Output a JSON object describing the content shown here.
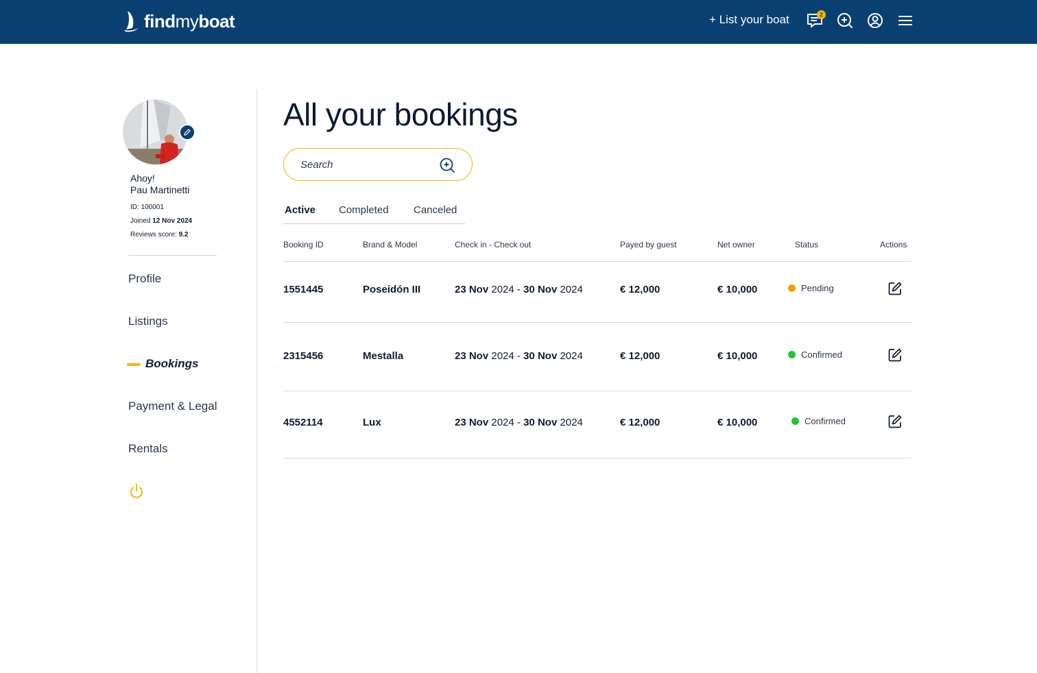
{
  "header": {
    "logo_text_bold_1": "find",
    "logo_text_light": "my",
    "logo_text_bold_2": "boat",
    "list_boat_label": "+ List your boat",
    "messages_badge": "2",
    "brand_color": "#0a3f72",
    "accent_color": "#f2b705"
  },
  "profile": {
    "greeting": "Ahoy!",
    "name": "Pau Martinetti",
    "id_label": "ID: ",
    "id_value": "100001",
    "joined_label": "Joined ",
    "joined_value": "12 Nov 2024",
    "reviews_label": "Reviews score: ",
    "reviews_value": "9.2"
  },
  "sidebar": {
    "items": [
      {
        "label": "Profile"
      },
      {
        "label": "Listings"
      },
      {
        "label": "Bookings"
      },
      {
        "label": "Payment & Legal"
      },
      {
        "label": "Rentals"
      }
    ]
  },
  "main": {
    "title": "All your bookings",
    "search_placeholder": "Search",
    "tabs": [
      {
        "label": "Active"
      },
      {
        "label": "Completed"
      },
      {
        "label": "Canceled"
      }
    ],
    "columns": [
      "Booking ID",
      "Brand & Model",
      "Check in - Check out",
      "Payed by guest",
      "Net owner",
      "Status",
      "Actions"
    ],
    "rows": [
      {
        "id": "1551445",
        "model": "Poseidón III",
        "checkin_day": "23 Nov",
        "checkin_year": " 2024",
        "sep": " - ",
        "checkout_day": "30 Nov",
        "checkout_year": " 2024",
        "paid": "€ 12,000",
        "net": "€ 10,000",
        "status": "Pending",
        "status_color": "#f5a300"
      },
      {
        "id": "2315456",
        "model": "Mestalla",
        "checkin_day": "23 Nov",
        "checkin_year": " 2024",
        "sep": " - ",
        "checkout_day": "30 Nov",
        "checkout_year": " 2024",
        "paid": "€ 12,000",
        "net": "€ 10,000",
        "status": "Confirmed",
        "status_color": "#1ec733"
      },
      {
        "id": "4552114",
        "model": "Lux",
        "checkin_day": "23 Nov",
        "checkin_year": " 2024",
        "sep": " - ",
        "checkout_day": "30 Nov",
        "checkout_year": " 2024",
        "paid": "€ 12,000",
        "net": "€ 10,000",
        "status": "Confirmed",
        "status_color": "#1ec733"
      }
    ]
  }
}
